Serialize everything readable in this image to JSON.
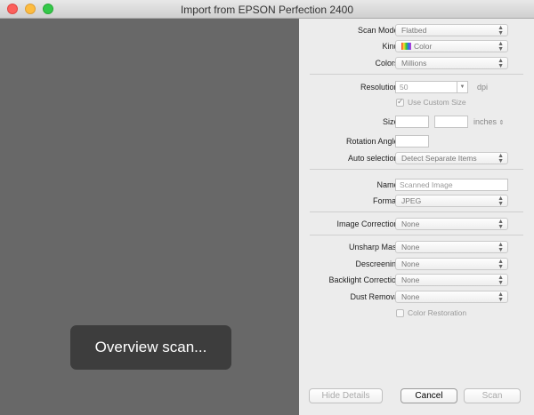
{
  "window": {
    "title": "Import from EPSON Perfection 2400"
  },
  "preview": {
    "overlay_text": "Overview scan..."
  },
  "settings": {
    "scan_mode": {
      "label": "Scan Mode:",
      "value": "Flatbed"
    },
    "kind": {
      "label": "Kind:",
      "value": "Color"
    },
    "colors": {
      "label": "Colors:",
      "value": "Millions"
    },
    "resolution": {
      "label": "Resolution:",
      "value": "50",
      "unit": "dpi"
    },
    "use_custom_size": {
      "label": "Use Custom Size",
      "checked": true
    },
    "size": {
      "label": "Size:",
      "width": "",
      "height": "",
      "unit": "inches"
    },
    "rotation_angle": {
      "label": "Rotation Angle:",
      "value": ""
    },
    "auto_selection": {
      "label": "Auto selection:",
      "value": "Detect Separate Items"
    },
    "name": {
      "label": "Name:",
      "value": "Scanned Image"
    },
    "format": {
      "label": "Format:",
      "value": "JPEG"
    },
    "image_correction": {
      "label": "Image Correction:",
      "value": "None"
    },
    "unsharp_mask": {
      "label": "Unsharp Mask",
      "value": "None"
    },
    "descreening": {
      "label": "Descreening",
      "value": "None"
    },
    "backlight_correction": {
      "label": "Backlight Correction",
      "value": "None"
    },
    "dust_removal": {
      "label": "Dust Removal",
      "value": "None"
    },
    "color_restoration": {
      "label": "Color Restoration",
      "checked": false
    }
  },
  "buttons": {
    "hide_details": "Hide Details",
    "cancel": "Cancel",
    "scan": "Scan"
  }
}
